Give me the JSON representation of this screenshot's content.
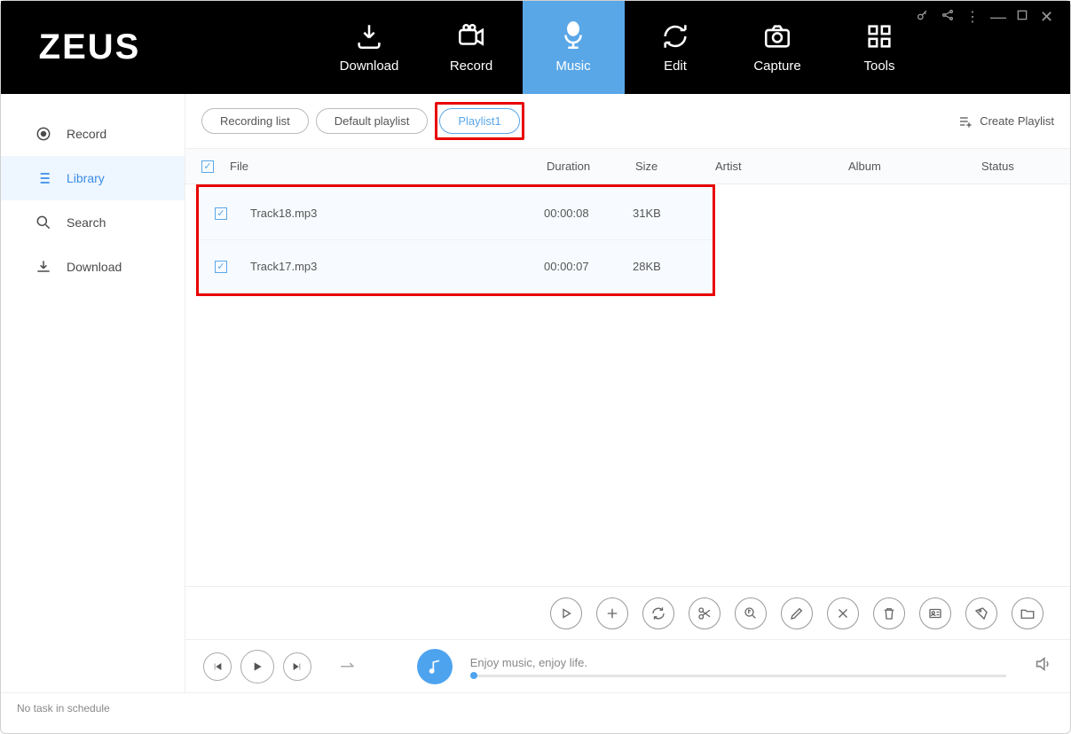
{
  "logo": "ZEUS",
  "nav": {
    "download": "Download",
    "record": "Record",
    "music": "Music",
    "edit": "Edit",
    "capture": "Capture",
    "tools": "Tools"
  },
  "sidebar": {
    "record": "Record",
    "library": "Library",
    "search": "Search",
    "download": "Download"
  },
  "pills": {
    "recording_list": "Recording list",
    "default_playlist": "Default playlist",
    "playlist1": "Playlist1"
  },
  "create_playlist": "Create Playlist",
  "columns": {
    "file": "File",
    "duration": "Duration",
    "size": "Size",
    "artist": "Artist",
    "album": "Album",
    "status": "Status"
  },
  "tracks": [
    {
      "file": "Track18.mp3",
      "duration": "00:00:08",
      "size": "31KB"
    },
    {
      "file": "Track17.mp3",
      "duration": "00:00:07",
      "size": "28KB"
    }
  ],
  "player_slogan": "Enjoy music, enjoy life.",
  "status_text": "No task in schedule"
}
